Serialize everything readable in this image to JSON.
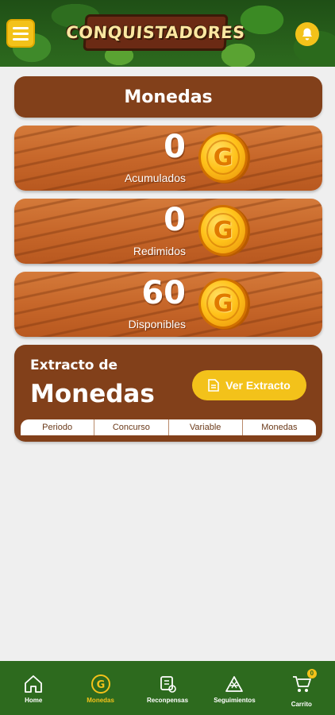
{
  "header": {
    "logo_text": "CONQUISTADORES",
    "menu_icon": "hamburger-menu-icon",
    "bell_icon": "bell-icon"
  },
  "title": "Monedas",
  "cards": [
    {
      "value": "0",
      "label": "Acumulados",
      "icon": "coin-g-icon"
    },
    {
      "value": "0",
      "label": "Redimidos",
      "icon": "coin-g-icon"
    },
    {
      "value": "60",
      "label": "Disponibles",
      "icon": "coin-g-icon"
    }
  ],
  "coin_letter": "G",
  "extract": {
    "title_small": "Extracto de",
    "title_big": "Monedas",
    "button_label": "Ver Extracto",
    "columns": [
      "Periodo",
      "Concurso",
      "Variable",
      "Monedas"
    ]
  },
  "nav": [
    {
      "label": "Home",
      "icon": "home-icon",
      "active": false
    },
    {
      "label": "Monedas",
      "icon": "coin-icon",
      "active": true
    },
    {
      "label": "Reconpensas",
      "icon": "rewards-icon",
      "active": false
    },
    {
      "label": "Seguimientos",
      "icon": "tracking-icon",
      "active": false
    },
    {
      "label": "Carrito",
      "icon": "cart-icon",
      "active": false,
      "badge": "0"
    }
  ],
  "colors": {
    "accent_yellow": "#f3c21a",
    "brown": "#82401a",
    "nav_green": "#2d6a1e"
  }
}
